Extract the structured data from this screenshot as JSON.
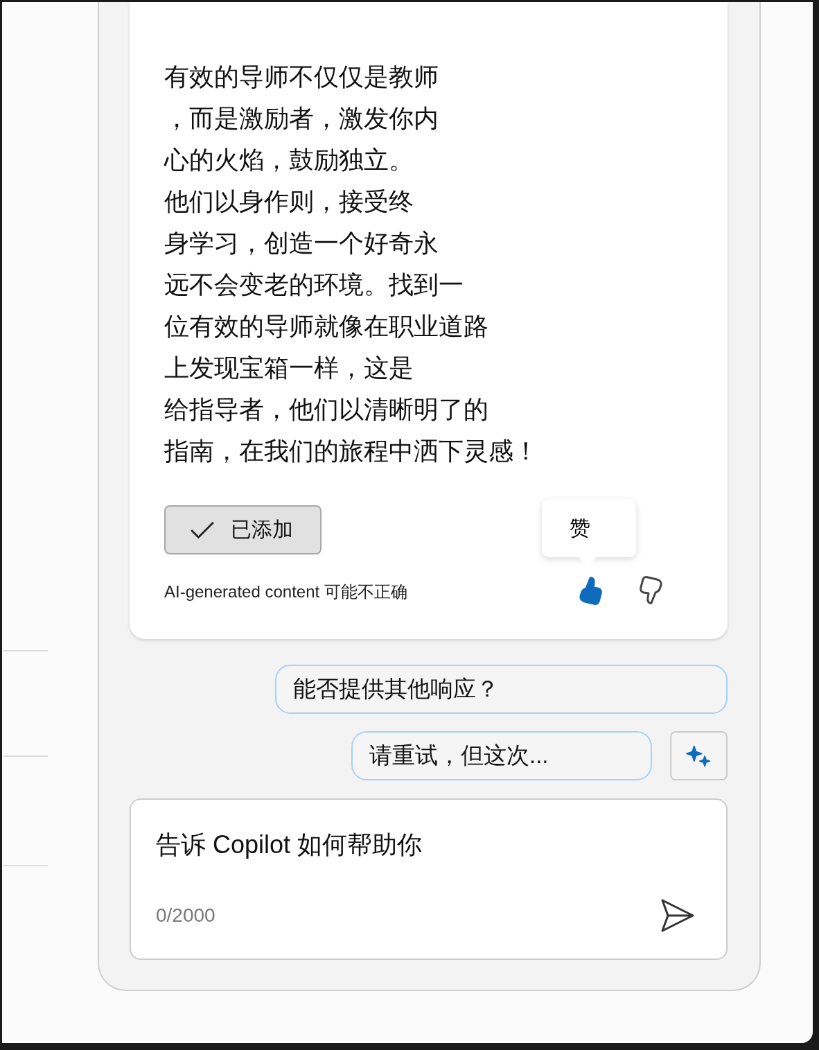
{
  "response": {
    "lines": [
      "有效的导师不仅仅是教师",
      "，而是激励者，激发你内",
      "心的火焰，鼓励独立。",
      "他们以身作则，接受终",
      "身学习，创造一个好奇永",
      "远不会变老的环境。找到一",
      "位有效的导师就像在职业道路",
      "上发现宝箱一样，这是",
      "给指导者，他们以清晰明了的",
      "指南，在我们的旅程中洒下灵感！"
    ],
    "add_button": {
      "label": "已添加",
      "checked": true
    },
    "disclaimer": "AI-generated content 可能不正确",
    "feedback": [
      {
        "kind": "like",
        "selected": true,
        "tooltip": "赞"
      },
      {
        "kind": "dislike",
        "selected": false
      }
    ]
  },
  "suggestions": [
    {
      "label": "能否提供其他响应？"
    },
    {
      "label": "请重试，但这次..."
    }
  ],
  "composer": {
    "placeholder": "告诉 Copilot 如何帮助你",
    "counter": "0/2000"
  }
}
